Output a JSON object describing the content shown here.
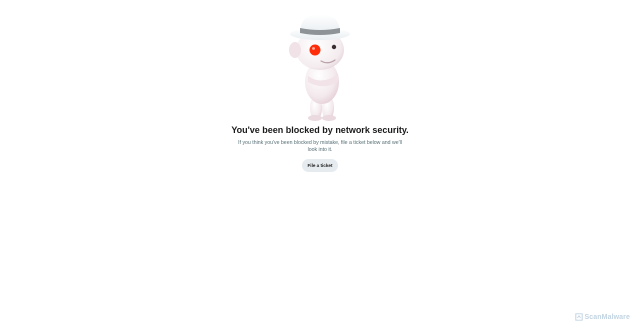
{
  "mascot": {
    "icon": "snoo-mascot-icon"
  },
  "blocked": {
    "headline": "You've been blocked by network security.",
    "message": "If you think you've been blocked by mistake, file a ticket below and we'll look into it.",
    "button_label": "File a ticket"
  },
  "watermark": {
    "text": "ScanMalware",
    "icon": "scanmalware-logo-icon"
  },
  "colors": {
    "button_bg": "#e5ebee",
    "eye": "#ff2d0a",
    "text": "#1a1a1b",
    "subtext": "#576f76"
  }
}
